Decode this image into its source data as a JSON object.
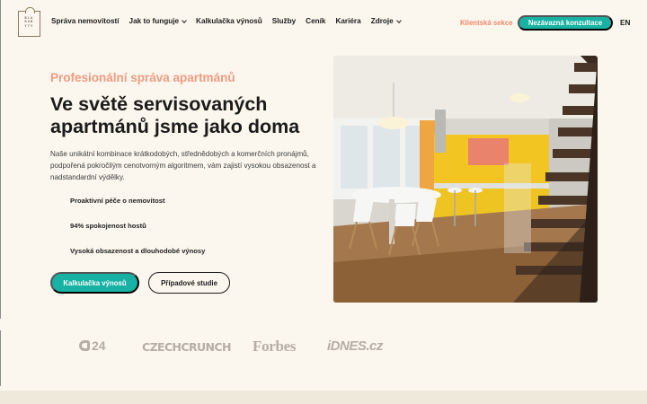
{
  "brand": {
    "logo_lines": [
      "BLA",
      "HOB",
      "YTY"
    ]
  },
  "nav": {
    "items": [
      {
        "label": "Správa nemovitostí",
        "dropdown": false
      },
      {
        "label": "Jak to funguje",
        "dropdown": true
      },
      {
        "label": "Kalkulačka výnosů",
        "dropdown": false
      },
      {
        "label": "Služby",
        "dropdown": false
      },
      {
        "label": "Ceník",
        "dropdown": false
      },
      {
        "label": "Kariéra",
        "dropdown": false
      },
      {
        "label": "Zdroje",
        "dropdown": true
      }
    ],
    "client_link": "Klientská sekce",
    "cta": "Nezávazná konzultace",
    "lang": "EN"
  },
  "hero": {
    "eyebrow": "Profesionální správa apartmánů",
    "headline": "Ve světě servisovaných apartmánů jsme jako doma",
    "intro": "Naše unikátní kombinace krátkodobých, střednědobých a komerčních pronájmů, podpořená pokročilým cenotvorným algoritmem, vám zajistí vysokou obsazenost a nadstandardní výdělky.",
    "features": [
      "Proaktivní péče o nemovitost",
      "94% spokojenost hostů",
      "Vysoká obsazenost a dlouhodobé výnosy"
    ],
    "primary_button": "Kalkulačka výnosů",
    "secondary_button": "Případové studie"
  },
  "press": {
    "ct": "24",
    "techcrunch": "CZECHCRUNCH",
    "forbes": "Forbes",
    "idnes": "iDNES.cz"
  },
  "colors": {
    "accent": "#17b2a3",
    "eyebrow": "#f29a80",
    "client_link": "#f1876c",
    "background": "#fbf7ee",
    "press_gray": "#b4aea4"
  }
}
